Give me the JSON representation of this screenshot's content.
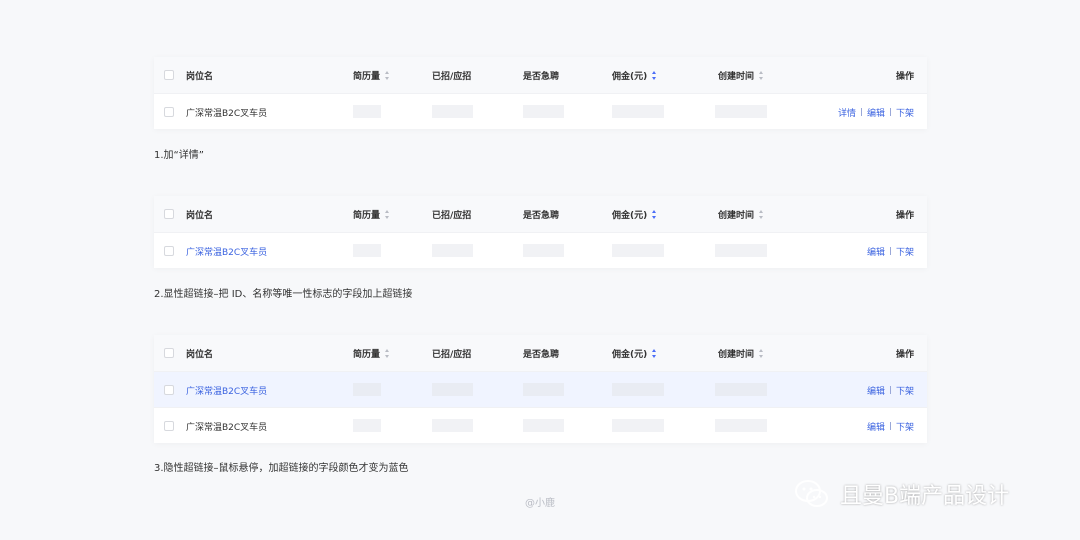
{
  "tables": [
    {
      "headers": {
        "name": "岗位名",
        "resume": "简历量",
        "hired": "已招/应招",
        "urgent": "是否急聘",
        "commission": "佣金(元)",
        "created": "创建时间",
        "ops": "操作"
      },
      "rows": [
        {
          "name": "广深常温B2C叉车员",
          "ops": [
            "详情",
            "编辑",
            "下架"
          ]
        }
      ],
      "caption": "1.加“详情”"
    },
    {
      "headers": {
        "name": "岗位名",
        "resume": "简历量",
        "hired": "已招/应招",
        "urgent": "是否急聘",
        "commission": "佣金(元)",
        "created": "创建时间",
        "ops": "操作"
      },
      "rows": [
        {
          "name": "广深常温B2C叉车员",
          "ops": [
            "编辑",
            "下架"
          ]
        }
      ],
      "caption": "2.显性超链接–把 ID、名称等唯一性标志的字段加上超链接"
    },
    {
      "headers": {
        "name": "岗位名",
        "resume": "简历量",
        "hired": "已招/应招",
        "urgent": "是否急聘",
        "commission": "佣金(元)",
        "created": "创建时间",
        "ops": "操作"
      },
      "rows": [
        {
          "name": "广深常温B2C叉车员",
          "ops": [
            "编辑",
            "下架"
          ]
        },
        {
          "name": "广深常温B2C叉车员",
          "ops": [
            "编辑",
            "下架"
          ]
        }
      ],
      "caption": "3.隐性超链接–鼠标悬停，加超链接的字段颜色才变为蓝色"
    }
  ],
  "credit": "@小鹿",
  "brand": "且曼B端产品设计",
  "colors": {
    "link": "#3b63e0",
    "hover_row": "#f0f4ff",
    "background": "#f7f8fa"
  }
}
